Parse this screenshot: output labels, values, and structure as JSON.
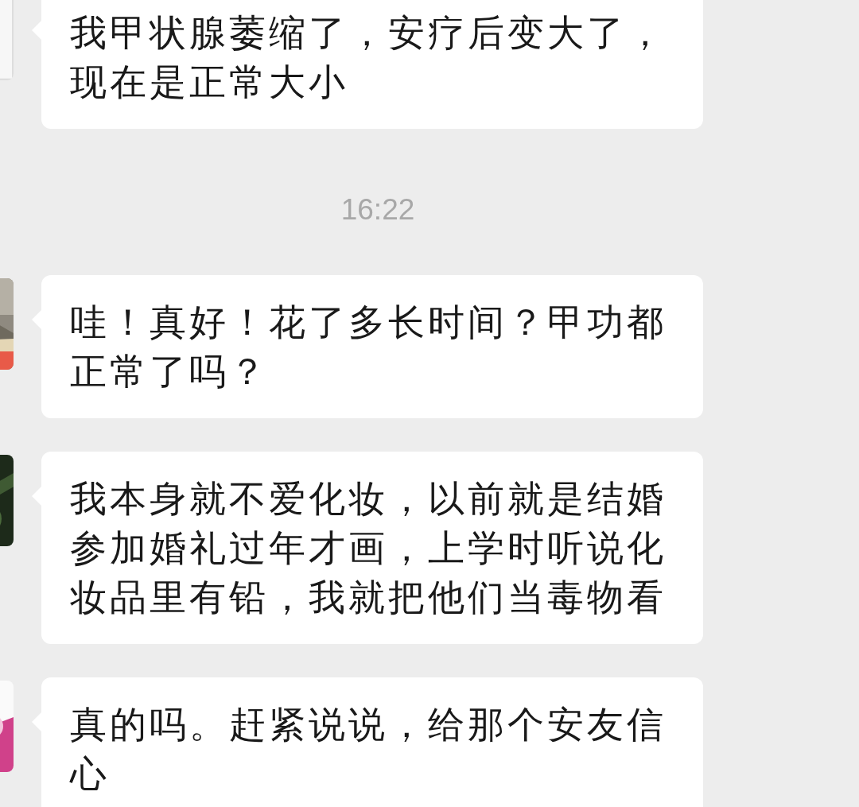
{
  "chat": [
    {
      "kind": "message",
      "text": "我甲状腺萎缩了，安疗后变大了，现在是正常大小"
    },
    {
      "kind": "time",
      "text": "16:22"
    },
    {
      "kind": "message",
      "text": "哇！真好！花了多长时间？甲功都正常了吗？"
    },
    {
      "kind": "message",
      "text": "我本身就不爱化妆，以前就是结婚参加婚礼过年才画，上学时听说化妆品里有铅，我就把他们当毒物看"
    },
    {
      "kind": "message",
      "text": "真的吗。赶紧说说，给那个安友信心"
    }
  ]
}
